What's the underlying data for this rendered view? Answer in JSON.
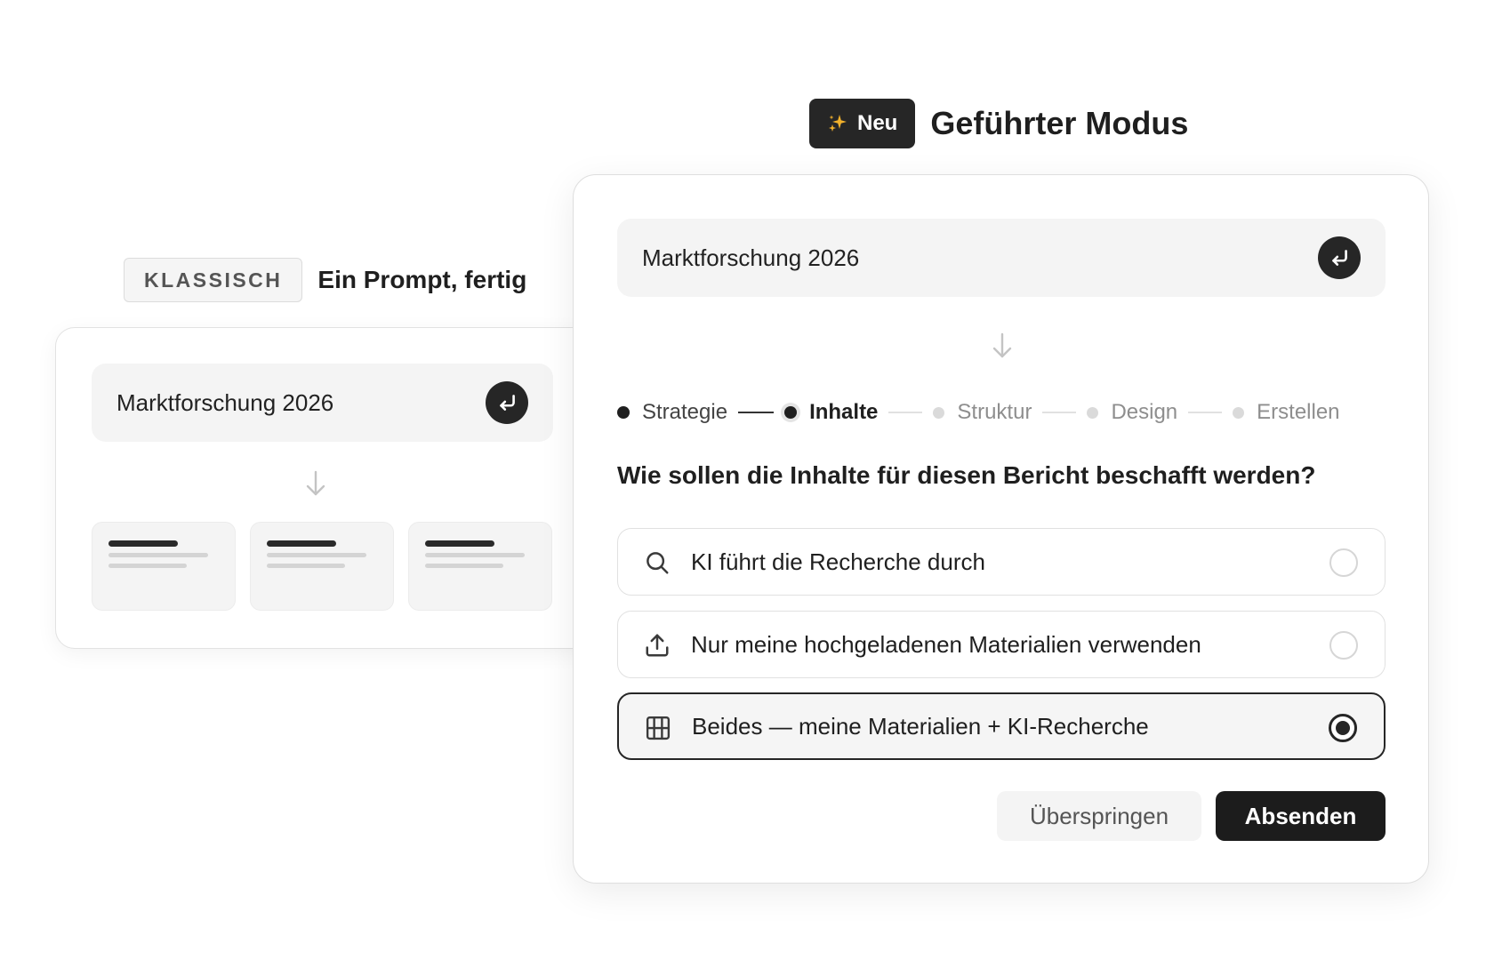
{
  "classic": {
    "badge": "KLASSISCH",
    "title": "Ein Prompt, fertig",
    "input_value": "Marktforschung 2026"
  },
  "guided": {
    "badge": "Neu",
    "title": "Geführter Modus",
    "input_value": "Marktforschung 2026",
    "steps": [
      {
        "label": "Strategie",
        "state": "done"
      },
      {
        "label": "Inhalte",
        "state": "active"
      },
      {
        "label": "Struktur",
        "state": "todo"
      },
      {
        "label": "Design",
        "state": "todo"
      },
      {
        "label": "Erstellen",
        "state": "todo"
      }
    ],
    "question": "Wie sollen die Inhalte für diesen Bericht beschafft werden?",
    "options": [
      {
        "label": "KI führt die Recherche durch",
        "icon": "search-icon",
        "selected": false
      },
      {
        "label": "Nur meine hochgeladenen Materialien verwenden",
        "icon": "upload-icon",
        "selected": false
      },
      {
        "label": "Beides — meine Materialien + KI-Recherche",
        "icon": "grid-icon",
        "selected": true
      }
    ],
    "skip_label": "Überspringen",
    "submit_label": "Absenden"
  },
  "colors": {
    "accent_dark": "#262626",
    "surface": "#f4f4f4",
    "border": "#e1e1e1",
    "sparkle": "#f2b12c"
  }
}
